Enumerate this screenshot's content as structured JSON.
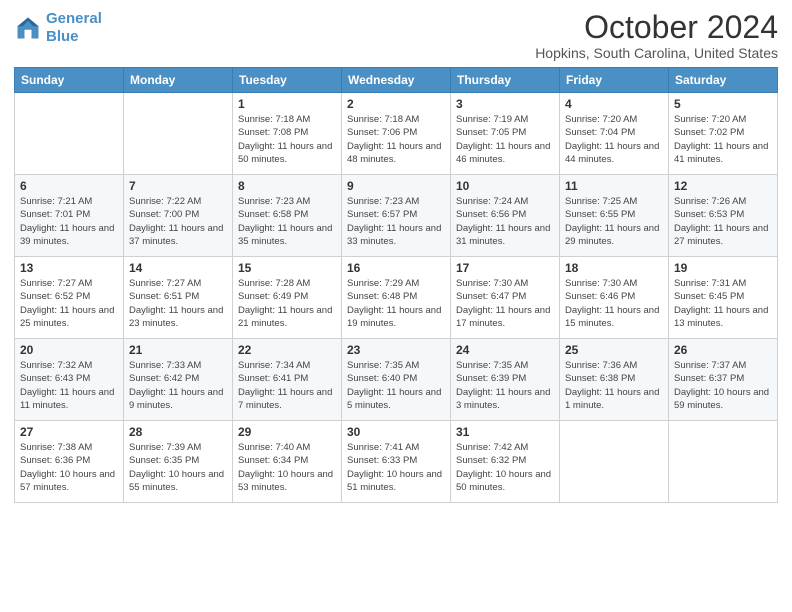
{
  "header": {
    "logo_line1": "General",
    "logo_line2": "Blue",
    "month": "October 2024",
    "location": "Hopkins, South Carolina, United States"
  },
  "weekdays": [
    "Sunday",
    "Monday",
    "Tuesday",
    "Wednesday",
    "Thursday",
    "Friday",
    "Saturday"
  ],
  "weeks": [
    [
      {
        "day": "",
        "info": ""
      },
      {
        "day": "",
        "info": ""
      },
      {
        "day": "1",
        "info": "Sunrise: 7:18 AM\nSunset: 7:08 PM\nDaylight: 11 hours and 50 minutes."
      },
      {
        "day": "2",
        "info": "Sunrise: 7:18 AM\nSunset: 7:06 PM\nDaylight: 11 hours and 48 minutes."
      },
      {
        "day": "3",
        "info": "Sunrise: 7:19 AM\nSunset: 7:05 PM\nDaylight: 11 hours and 46 minutes."
      },
      {
        "day": "4",
        "info": "Sunrise: 7:20 AM\nSunset: 7:04 PM\nDaylight: 11 hours and 44 minutes."
      },
      {
        "day": "5",
        "info": "Sunrise: 7:20 AM\nSunset: 7:02 PM\nDaylight: 11 hours and 41 minutes."
      }
    ],
    [
      {
        "day": "6",
        "info": "Sunrise: 7:21 AM\nSunset: 7:01 PM\nDaylight: 11 hours and 39 minutes."
      },
      {
        "day": "7",
        "info": "Sunrise: 7:22 AM\nSunset: 7:00 PM\nDaylight: 11 hours and 37 minutes."
      },
      {
        "day": "8",
        "info": "Sunrise: 7:23 AM\nSunset: 6:58 PM\nDaylight: 11 hours and 35 minutes."
      },
      {
        "day": "9",
        "info": "Sunrise: 7:23 AM\nSunset: 6:57 PM\nDaylight: 11 hours and 33 minutes."
      },
      {
        "day": "10",
        "info": "Sunrise: 7:24 AM\nSunset: 6:56 PM\nDaylight: 11 hours and 31 minutes."
      },
      {
        "day": "11",
        "info": "Sunrise: 7:25 AM\nSunset: 6:55 PM\nDaylight: 11 hours and 29 minutes."
      },
      {
        "day": "12",
        "info": "Sunrise: 7:26 AM\nSunset: 6:53 PM\nDaylight: 11 hours and 27 minutes."
      }
    ],
    [
      {
        "day": "13",
        "info": "Sunrise: 7:27 AM\nSunset: 6:52 PM\nDaylight: 11 hours and 25 minutes."
      },
      {
        "day": "14",
        "info": "Sunrise: 7:27 AM\nSunset: 6:51 PM\nDaylight: 11 hours and 23 minutes."
      },
      {
        "day": "15",
        "info": "Sunrise: 7:28 AM\nSunset: 6:49 PM\nDaylight: 11 hours and 21 minutes."
      },
      {
        "day": "16",
        "info": "Sunrise: 7:29 AM\nSunset: 6:48 PM\nDaylight: 11 hours and 19 minutes."
      },
      {
        "day": "17",
        "info": "Sunrise: 7:30 AM\nSunset: 6:47 PM\nDaylight: 11 hours and 17 minutes."
      },
      {
        "day": "18",
        "info": "Sunrise: 7:30 AM\nSunset: 6:46 PM\nDaylight: 11 hours and 15 minutes."
      },
      {
        "day": "19",
        "info": "Sunrise: 7:31 AM\nSunset: 6:45 PM\nDaylight: 11 hours and 13 minutes."
      }
    ],
    [
      {
        "day": "20",
        "info": "Sunrise: 7:32 AM\nSunset: 6:43 PM\nDaylight: 11 hours and 11 minutes."
      },
      {
        "day": "21",
        "info": "Sunrise: 7:33 AM\nSunset: 6:42 PM\nDaylight: 11 hours and 9 minutes."
      },
      {
        "day": "22",
        "info": "Sunrise: 7:34 AM\nSunset: 6:41 PM\nDaylight: 11 hours and 7 minutes."
      },
      {
        "day": "23",
        "info": "Sunrise: 7:35 AM\nSunset: 6:40 PM\nDaylight: 11 hours and 5 minutes."
      },
      {
        "day": "24",
        "info": "Sunrise: 7:35 AM\nSunset: 6:39 PM\nDaylight: 11 hours and 3 minutes."
      },
      {
        "day": "25",
        "info": "Sunrise: 7:36 AM\nSunset: 6:38 PM\nDaylight: 11 hours and 1 minute."
      },
      {
        "day": "26",
        "info": "Sunrise: 7:37 AM\nSunset: 6:37 PM\nDaylight: 10 hours and 59 minutes."
      }
    ],
    [
      {
        "day": "27",
        "info": "Sunrise: 7:38 AM\nSunset: 6:36 PM\nDaylight: 10 hours and 57 minutes."
      },
      {
        "day": "28",
        "info": "Sunrise: 7:39 AM\nSunset: 6:35 PM\nDaylight: 10 hours and 55 minutes."
      },
      {
        "day": "29",
        "info": "Sunrise: 7:40 AM\nSunset: 6:34 PM\nDaylight: 10 hours and 53 minutes."
      },
      {
        "day": "30",
        "info": "Sunrise: 7:41 AM\nSunset: 6:33 PM\nDaylight: 10 hours and 51 minutes."
      },
      {
        "day": "31",
        "info": "Sunrise: 7:42 AM\nSunset: 6:32 PM\nDaylight: 10 hours and 50 minutes."
      },
      {
        "day": "",
        "info": ""
      },
      {
        "day": "",
        "info": ""
      }
    ]
  ]
}
